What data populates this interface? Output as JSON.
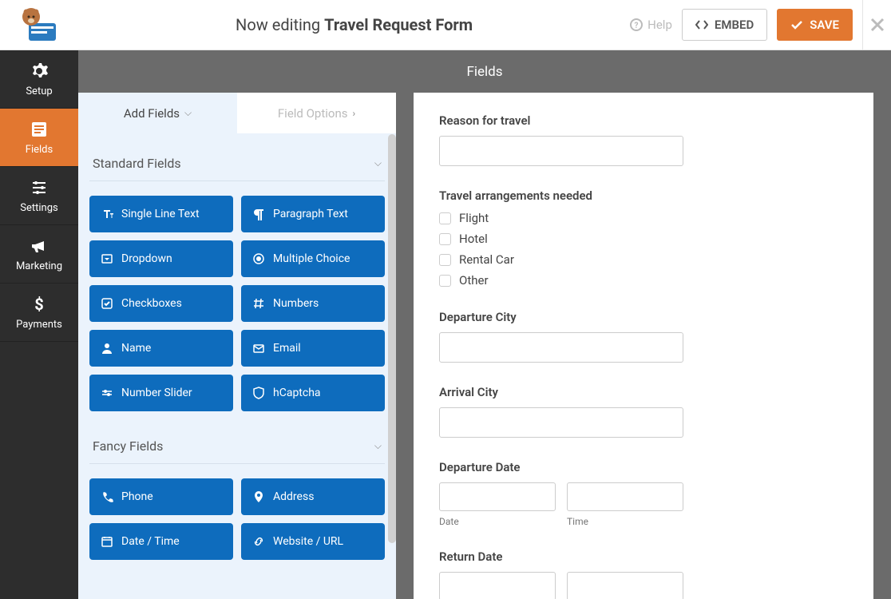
{
  "header": {
    "title_prefix": "Now editing",
    "title_bold": "Travel Request Form",
    "help": "Help",
    "embed": "EMBED",
    "save": "SAVE"
  },
  "sidebar": [
    {
      "label": "Setup",
      "icon": "gear"
    },
    {
      "label": "Fields",
      "icon": "form",
      "active": true
    },
    {
      "label": "Settings",
      "icon": "sliders"
    },
    {
      "label": "Marketing",
      "icon": "bullhorn"
    },
    {
      "label": "Payments",
      "icon": "dollar"
    }
  ],
  "panel": {
    "title": "Fields",
    "tabs": [
      {
        "label": "Add Fields",
        "active": true
      },
      {
        "label": "Field Options",
        "active": false
      }
    ],
    "sections": [
      {
        "title": "Standard Fields",
        "items": [
          {
            "label": "Single Line Text",
            "icon": "text"
          },
          {
            "label": "Paragraph Text",
            "icon": "paragraph"
          },
          {
            "label": "Dropdown",
            "icon": "dropdown"
          },
          {
            "label": "Multiple Choice",
            "icon": "radio"
          },
          {
            "label": "Checkboxes",
            "icon": "check"
          },
          {
            "label": "Numbers",
            "icon": "hash"
          },
          {
            "label": "Name",
            "icon": "user"
          },
          {
            "label": "Email",
            "icon": "mail"
          },
          {
            "label": "Number Slider",
            "icon": "slider"
          },
          {
            "label": "hCaptcha",
            "icon": "shield"
          }
        ]
      },
      {
        "title": "Fancy Fields",
        "items": [
          {
            "label": "Phone",
            "icon": "phone"
          },
          {
            "label": "Address",
            "icon": "pin"
          },
          {
            "label": "Date / Time",
            "icon": "calendar"
          },
          {
            "label": "Website / URL",
            "icon": "link"
          }
        ]
      }
    ]
  },
  "form": {
    "reason_label": "Reason for travel",
    "arrangements_label": "Travel arrangements needed",
    "arrangements": [
      "Flight",
      "Hotel",
      "Rental Car",
      "Other"
    ],
    "dep_city_label": "Departure City",
    "arr_city_label": "Arrival City",
    "dep_date_label": "Departure Date",
    "ret_date_label": "Return Date",
    "sub_date": "Date",
    "sub_time": "Time"
  }
}
